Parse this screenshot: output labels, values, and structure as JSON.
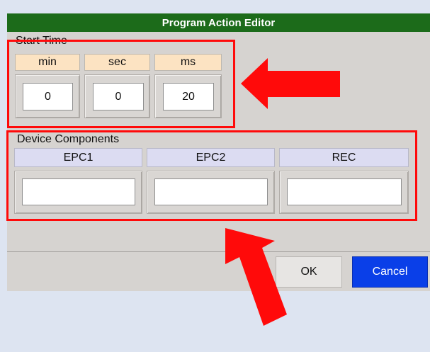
{
  "window": {
    "title": "Program Action Editor"
  },
  "start_time": {
    "label": "Start Time",
    "columns": [
      {
        "header": "min",
        "value": "0"
      },
      {
        "header": "sec",
        "value": "0"
      },
      {
        "header": "ms",
        "value": "20"
      }
    ]
  },
  "device_components": {
    "label": "Device Components",
    "columns": [
      {
        "header": "EPC1",
        "value": ""
      },
      {
        "header": "EPC2",
        "value": ""
      },
      {
        "header": "REC",
        "value": ""
      }
    ]
  },
  "buttons": {
    "ok": "OK",
    "cancel": "Cancel"
  },
  "colors": {
    "title_bar": "#1c6b1a",
    "time_header": "#fce3c2",
    "device_header": "#dcdcf2",
    "cancel_button": "#0a3fe8",
    "highlight": "#ff0a0a"
  }
}
